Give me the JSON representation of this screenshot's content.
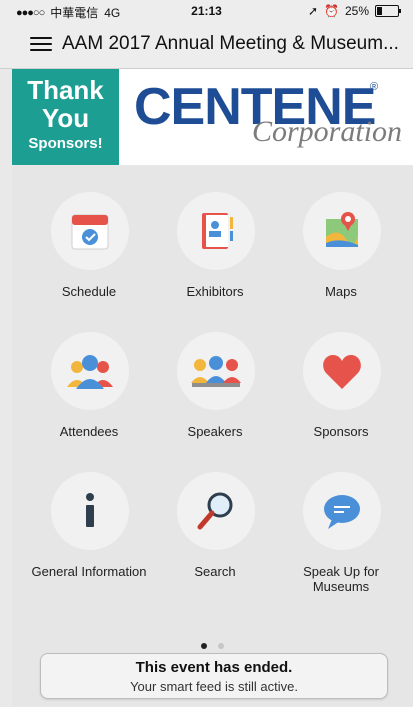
{
  "status_bar": {
    "carrier": "中華電信",
    "network": "4G",
    "time": "21:13",
    "battery": "25%",
    "battery_level": 0.25
  },
  "nav": {
    "title": "AAM 2017 Annual Meeting & Museum..."
  },
  "sponsor_banner": {
    "thanks_line1": "Thank",
    "thanks_line2": "You",
    "thanks_line3": "Sponsors!",
    "brand": "CENTENE",
    "brand_sub": "Corporation",
    "colors": {
      "teal": "#1d9e93",
      "brand_blue": "#1e4d95"
    }
  },
  "tiles": [
    {
      "label": "Schedule",
      "icon": "calendar-icon"
    },
    {
      "label": "Exhibitors",
      "icon": "notebook-icon"
    },
    {
      "label": "Maps",
      "icon": "map-icon"
    },
    {
      "label": "Attendees",
      "icon": "people-group-icon"
    },
    {
      "label": "Speakers",
      "icon": "speakers-group-icon"
    },
    {
      "label": "Sponsors",
      "icon": "heart-icon"
    },
    {
      "label": "General Information",
      "icon": "info-icon"
    },
    {
      "label": "Search",
      "icon": "magnifier-icon"
    },
    {
      "label": "Speak Up for Museums",
      "icon": "chat-bubble-icon"
    }
  ],
  "pager": {
    "pages": 2,
    "active": 1
  },
  "ended_notice": {
    "title": "This event has ended.",
    "subtitle": "Your smart feed is still active."
  }
}
